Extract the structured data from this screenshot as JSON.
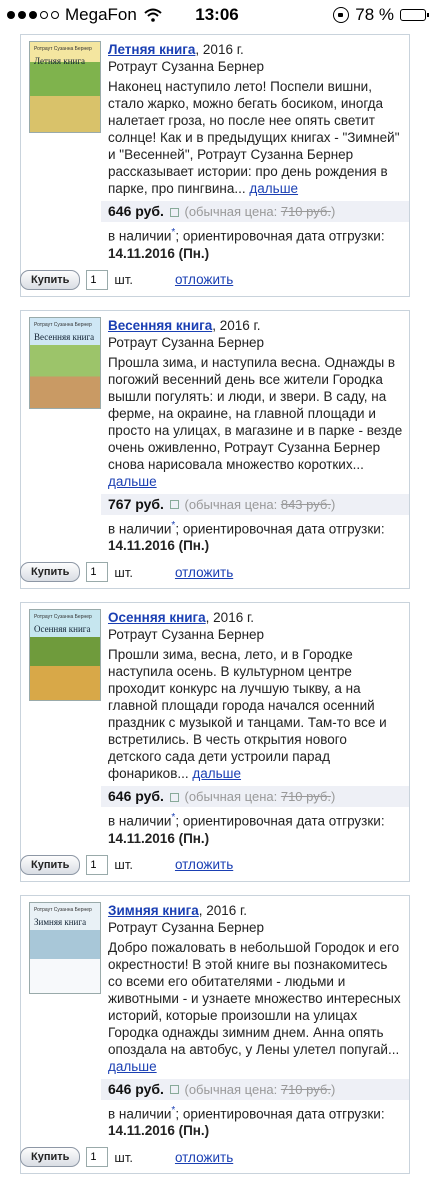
{
  "status_bar": {
    "carrier": "MegaFon",
    "time": "13:06",
    "battery": "78 %",
    "battery_level": 0.78
  },
  "labels": {
    "price_regular_prefix": "(обычная цена:",
    "price_regular_suffix": ")",
    "availability": "в наличии",
    "star": "*",
    "ship_prefix": "; ориентировочная дата отгрузки:",
    "buy": "Купить",
    "qty_default": "1",
    "qty_unit": "шт.",
    "postpone": "отложить",
    "more": "дальше"
  },
  "books": [
    {
      "title": "Летняя книга",
      "year": ", 2016 г.",
      "author": "Ротраут Сузанна Бернер",
      "cover_author": "Ротраут Сузанна Бернер",
      "cover_title": "Летняя книга",
      "description": "Наконец наступило лето! Поспели вишни, стало жарко, можно бегать босиком, иногда налетает гроза, но после нее опять светит солнце! Как и в предыдущих книгах - \"Зимней\" и \"Весенней\", Ротраут Сузанна Бернер рассказывает истории: про день рождения в парке, про пингвина...",
      "price": "646 руб.",
      "regular_price": "710 руб.",
      "ship_date": "14.11.2016 (Пн.)"
    },
    {
      "title": "Весенняя книга",
      "year": ", 2016 г.",
      "author": "Ротраут Сузанна Бернер",
      "cover_author": "Ротраут Сузанна Бернер",
      "cover_title": "Весенняя книга",
      "description": "Прошла зима, и наступила весна. Однажды в погожий весенний день все жители Городка вышли погулять: и люди, и звери. В саду, на ферме, на окраине, на главной площади и просто на улицах, в магазине и в парке - везде очень оживленно, Ротраут Сузанна Бернер снова нарисовала множество коротких...",
      "price": "767 руб.",
      "regular_price": "843 руб.",
      "ship_date": "14.11.2016 (Пн.)"
    },
    {
      "title": "Осенняя книга",
      "year": ", 2016 г.",
      "author": "Ротраут Сузанна Бернер",
      "cover_author": "Ротраут Сузанна Бернер",
      "cover_title": "Осенняя книга",
      "description": "Прошли зима, весна, лето, и в Городке наступила осень. В культурном центре проходит конкурс на лучшую тыкву, а на главной площади города начался осенний праздник с музыкой и танцами. Там-то все и встретились. В честь открытия нового детского сада дети устроили парад фонариков...",
      "price": "646 руб.",
      "regular_price": "710 руб.",
      "ship_date": "14.11.2016 (Пн.)"
    },
    {
      "title": "Зимняя книга",
      "year": ", 2016 г.",
      "author": "Ротраут Сузанна Бернер",
      "cover_author": "Ротраут Сузанна Бернер",
      "cover_title": "Зимняя книга",
      "description": "Добро пожаловать в небольшой Городок и его окрестности! В этой книге вы познакомитесь со всеми его обитателями - людьми и животными - и узнаете множество интересных историй, которые произошли на улицах Городка однажды зимним днем. Анна опять опоздала на автобус, у Лены улетел попугай...",
      "price": "646 руб.",
      "regular_price": "710 руб.",
      "ship_date": "14.11.2016 (Пн.)"
    }
  ]
}
